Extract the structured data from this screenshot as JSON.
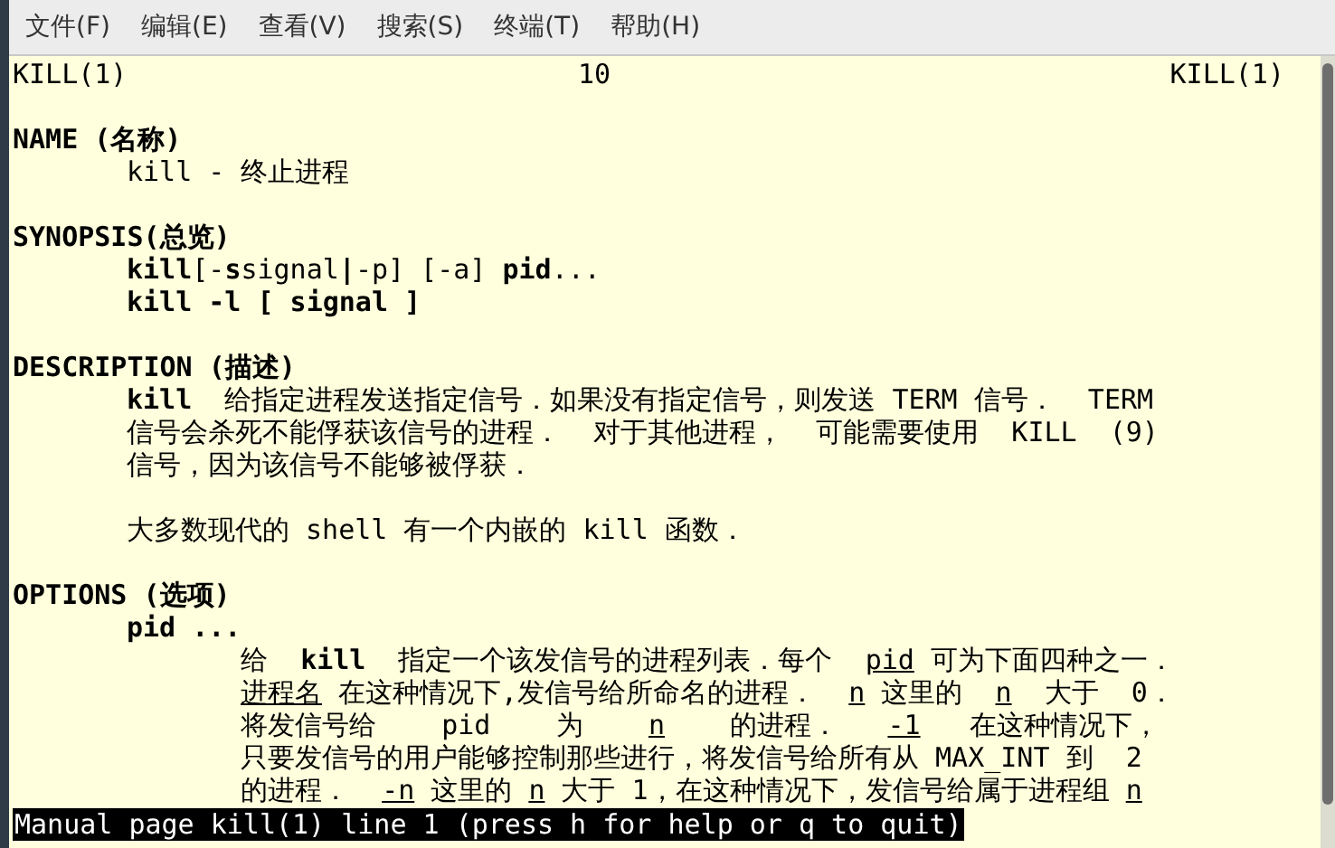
{
  "menu": [
    "文件(F)",
    "编辑(E)",
    "查看(V)",
    "搜索(S)",
    "终端(T)",
    "帮助(H)"
  ],
  "header": {
    "left": "KILL(1)",
    "center": "10",
    "right": "KILL(1)"
  },
  "lines": [
    {
      "kind": "blank"
    },
    {
      "kind": "heading",
      "text": "NAME (名称)"
    },
    {
      "kind": "body",
      "text": "kill - 终止进程"
    },
    {
      "kind": "blank"
    },
    {
      "kind": "heading",
      "text": "SYNOPSIS(总览)"
    },
    {
      "kind": "body",
      "text": "**kill**[-**s**signal**|**-p] [-a] **pid**..."
    },
    {
      "kind": "command",
      "text": "kill -l [ signal ]"
    },
    {
      "kind": "blank"
    },
    {
      "kind": "heading",
      "text": "DESCRIPTION (描述)"
    },
    {
      "kind": "body",
      "text": "**kill**  给指定进程发送指定信号．如果没有指定信号，则发送 TERM 信号．  TERM"
    },
    {
      "kind": "body",
      "text": "信号会杀死不能俘获该信号的进程．  对于其他进程，  可能需要使用  KILL  (9)"
    },
    {
      "kind": "body",
      "text": "信号，因为该信号不能够被俘获．"
    },
    {
      "kind": "blank"
    },
    {
      "kind": "body",
      "text": "大多数现代的 shell 有一个内嵌的 kill 函数．"
    },
    {
      "kind": "blank"
    },
    {
      "kind": "heading",
      "text": "OPTIONS (选项)"
    },
    {
      "kind": "command",
      "text": "pid ..."
    },
    {
      "kind": "option",
      "text": "给  **kill**  指定一个该发信号的进程列表．每个  *pid* 可为下面四种之一．"
    },
    {
      "kind": "option",
      "text": "*进程名* 在这种情况下,发信号给所命名的进程．  *n* 这里的  *n*  大于  0．"
    },
    {
      "kind": "option",
      "text": "将发信号给    pid    为    *n*    的进程．   *-1*   在这种情况下，"
    },
    {
      "kind": "option",
      "text": "只要发信号的用户能够控制那些进行，将发信号给所有从 MAX_INT 到  2"
    },
    {
      "kind": "option",
      "text": "的进程．  *-n* 这里的 *n* 大于 1，在这种情况下，发信号给属于进程组 *n*"
    }
  ],
  "status_bar": "Manual page kill(1) line 1 (press h for help or q to quit)"
}
